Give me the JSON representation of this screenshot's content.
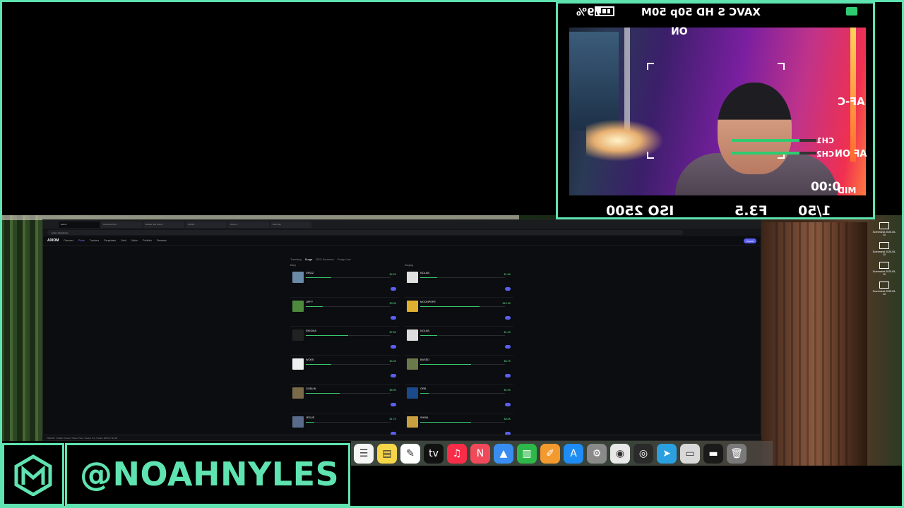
{
  "camera_hud": {
    "battery": "79%",
    "format": "XAVC S HD 50p 50M",
    "steady": "ON",
    "af_mode": "AF-C",
    "ch1": "CH1",
    "ch2": "CH2",
    "face_af": "AF ON",
    "timecode": "0:00",
    "mid": "MID",
    "shutter": "1/50",
    "aperture": "F3.5",
    "iso": "ISO 2500"
  },
  "browser": {
    "tabs": [
      "Axiom",
      "Ketamine/coin...",
      "Bubble Tea Pump...",
      "0x4f5e...",
      "Ascent...",
      "New Tab"
    ],
    "url": "axiom.trade/pulse",
    "site": {
      "logo": "AXIOM",
      "nav": [
        "Discover",
        "Pulse",
        "Trackers",
        "Perpetuals",
        "Yield",
        "Vision",
        "Portfolio",
        "Rewards"
      ],
      "active_nav": "Pulse",
      "connect": "Deposit"
    },
    "pulse": {
      "tabs": [
        "Trending",
        "Surge",
        "DEX Screener",
        "Pump Live"
      ],
      "active_tab": "Surge",
      "columns": [
        {
          "title": "Early",
          "cards": [
            {
              "name": "DRIZZ",
              "mc": "$4.2K",
              "thumb": "#6a8aa8",
              "fill": 0.3
            },
            {
              "name": "JIFFY",
              "mc": "$3.9K",
              "thumb": "#4e8a3e",
              "fill": 0.2
            },
            {
              "name": "ENIGMA",
              "mc": "$7.6K",
              "thumb": "#222222",
              "fill": 0.5
            },
            {
              "name": "WOKE",
              "mc": "$4.4K",
              "thumb": "#f0f0f0",
              "fill": 0.3
            },
            {
              "name": "GOBLIN",
              "mc": "$5.9K",
              "thumb": "#7a6a4a",
              "fill": 0.4
            },
            {
              "name": "JESUS",
              "mc": "$1.7K",
              "thumb": "#5a6a8a",
              "fill": 0.1
            }
          ]
        },
        {
          "title": "Surging",
          "cards": [
            {
              "name": "NOLAB",
              "mc": "$1.6K",
              "thumb": "#e0e0e0",
              "fill": 0.2
            },
            {
              "name": "MOONPEPE",
              "mc": "$10.9K",
              "thumb": "#e0b030",
              "fill": 0.7
            },
            {
              "name": "NOLAB",
              "mc": "$1.4K",
              "thumb": "#dcdcdc",
              "fill": 0.2
            },
            {
              "name": "BASED",
              "mc": "$8.7K",
              "thumb": "#6a7a4a",
              "fill": 0.6
            },
            {
              "name": "ORB",
              "mc": "$0.9K",
              "thumb": "#1a4a8a",
              "fill": 0.1
            },
            {
              "name": "SHIBA",
              "mc": "$8.6K",
              "thumb": "#c8a040",
              "fill": 0.6
            }
          ]
        }
      ]
    },
    "status": "PRESET 1   Wallet Tracker   Twitter   Pulse Tracker   PnL Tracker   $186.27   $3.98"
  },
  "desktop_icons": [
    "Screenshot 2025-05-10",
    "Screenshot 2025-05-10",
    "Screenshot 2025-05-10",
    "Screenshot 2025-05-10"
  ],
  "dock_apps": [
    {
      "name": "reminders",
      "glyph": "☰",
      "color": "#f5f5f5"
    },
    {
      "name": "notes",
      "glyph": "▤",
      "color": "#f7d64a"
    },
    {
      "name": "freeform",
      "glyph": "✎",
      "color": "#ffffff"
    },
    {
      "name": "tv",
      "glyph": "tv",
      "color": "#111111"
    },
    {
      "name": "music",
      "glyph": "♫",
      "color": "#fa2d48"
    },
    {
      "name": "news",
      "glyph": "N",
      "color": "#f04a5a"
    },
    {
      "name": "keynote",
      "glyph": "▲",
      "color": "#3a8df0"
    },
    {
      "name": "numbers",
      "glyph": "▥",
      "color": "#2fb84a"
    },
    {
      "name": "pages",
      "glyph": "✐",
      "color": "#f29a2e"
    },
    {
      "name": "app-store",
      "glyph": "A",
      "color": "#1e8cf5"
    },
    {
      "name": "system-settings",
      "glyph": "⚙",
      "color": "#8a8a8a"
    },
    {
      "name": "chrome",
      "glyph": "◉",
      "color": "#e8e8e8"
    },
    {
      "name": "activity-monitor",
      "glyph": "◎",
      "color": "#2a2a2a"
    },
    {
      "name": "telegram",
      "glyph": "➤",
      "color": "#2aa0e0"
    },
    {
      "name": "downloads",
      "glyph": "▭",
      "color": "#d8d8d8"
    },
    {
      "name": "window",
      "glyph": "▬",
      "color": "#1a1a1a"
    },
    {
      "name": "trash",
      "glyph": "🗑",
      "color": "#7a7a7a"
    }
  ],
  "branding": {
    "logo_letters": "NM",
    "handle": "@NOAHNYLES",
    "accent": "#5fe3b0"
  }
}
